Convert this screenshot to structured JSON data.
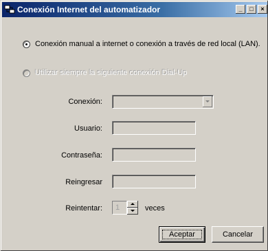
{
  "window": {
    "title": "Conexión Internet del automatizador",
    "controls": {
      "minimize": "_",
      "maximize": "□",
      "close": "×"
    }
  },
  "options": {
    "manual": {
      "label": "Conexión manual a internet o conexión a través de red local (LAN).",
      "checked": true
    },
    "dialup": {
      "label": "Utilizar siempre la siguiente conexión Dial-Up",
      "checked": false,
      "enabled": false
    }
  },
  "fields": {
    "connection": {
      "label": "Conexión:",
      "value": ""
    },
    "user": {
      "label": "Usuario:",
      "value": ""
    },
    "password": {
      "label": "Contraseña:",
      "value": ""
    },
    "reenter": {
      "label": "Reingresar",
      "value": ""
    },
    "retry": {
      "label": "Reintentar:",
      "value": "1",
      "suffix": "veces"
    }
  },
  "buttons": {
    "accept": "Aceptar",
    "cancel": "Cancelar"
  },
  "icons": [
    "network-connection-icon",
    "chevron-down-icon",
    "spin-up-icon",
    "spin-down-icon"
  ]
}
